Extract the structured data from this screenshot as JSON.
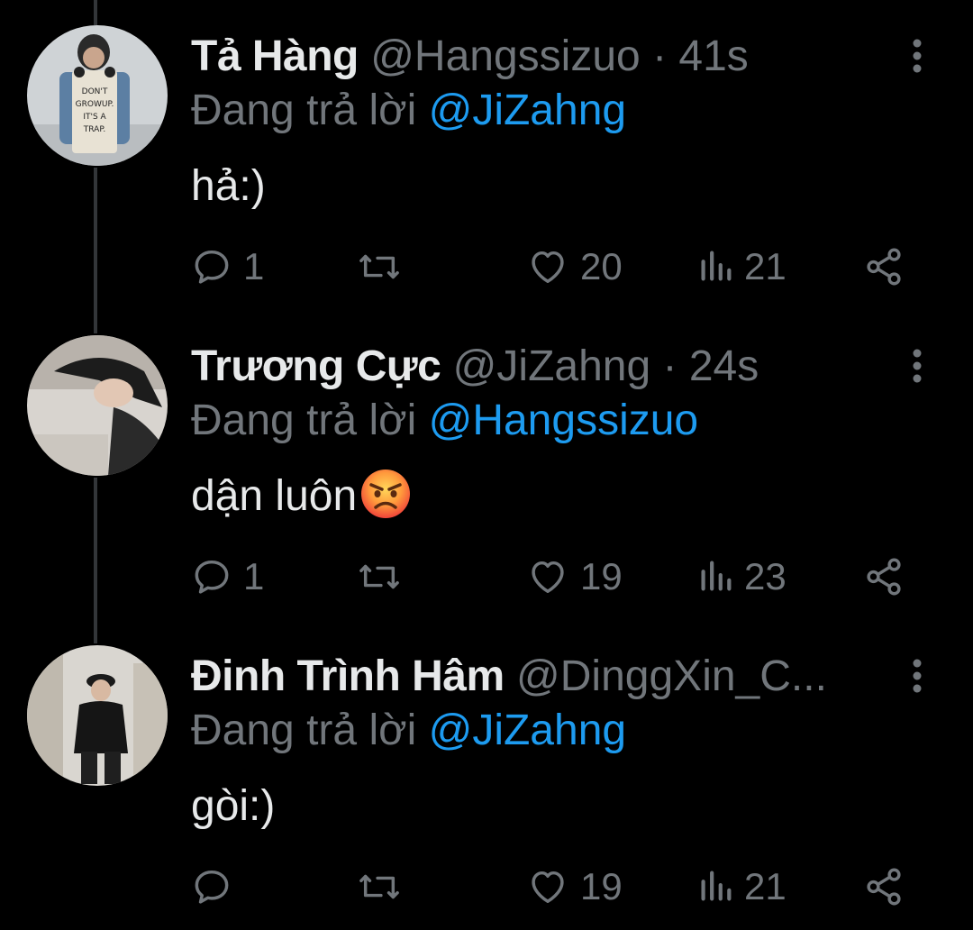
{
  "tweets": [
    {
      "name": "Tả Hàng",
      "handle": "@Hangssizuo",
      "separator": "·",
      "time": "41s",
      "replying_prefix": "Đang trả lời",
      "replying_to": "@JiZahng",
      "text": "hả:)",
      "emoji": "",
      "replies": "1",
      "retweets": "",
      "likes": "20",
      "views": "21",
      "avatar_caption": "DON'T GROWUP. IT'S A TRAP."
    },
    {
      "name": "Trương Cực",
      "handle": "@JiZahng",
      "separator": "·",
      "time": "24s",
      "replying_prefix": "Đang trả lời",
      "replying_to": "@Hangssizuo",
      "text": "dận luôn",
      "emoji": "angry-face",
      "replies": "1",
      "retweets": "",
      "likes": "19",
      "views": "23"
    },
    {
      "name": "Đinh Trình Hâm",
      "handle": "@DinggXin_C...",
      "separator": "",
      "time": "",
      "replying_prefix": "Đang trả lời",
      "replying_to": "@JiZahng",
      "text": "gòi:)",
      "emoji": "",
      "replies": "",
      "retweets": "",
      "likes": "19",
      "views": "21"
    }
  ],
  "icons": [
    "reply-icon",
    "retweet-icon",
    "like-icon",
    "views-icon",
    "share-icon",
    "more-options-icon"
  ],
  "colors": {
    "background": "#000000",
    "text_primary": "#e7e9ea",
    "text_secondary": "#71767b",
    "accent": "#1d9bf0",
    "thread_line": "#333639"
  }
}
